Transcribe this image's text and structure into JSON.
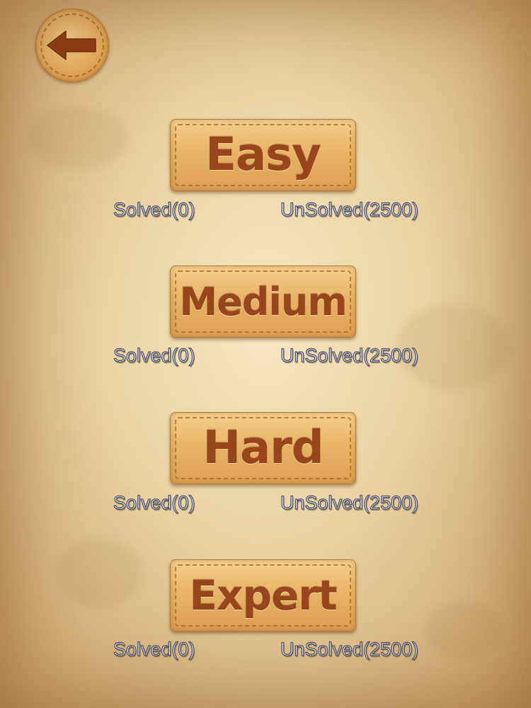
{
  "back_button": {
    "icon": "arrow-left-icon"
  },
  "levels": [
    {
      "label": "Easy",
      "solved": "Solved(0)",
      "unsolved": "UnSolved(2500)"
    },
    {
      "label": "Medium",
      "solved": "Solved(0)",
      "unsolved": "UnSolved(2500)"
    },
    {
      "label": "Hard",
      "solved": "Solved(0)",
      "unsolved": "UnSolved(2500)"
    },
    {
      "label": "Expert",
      "solved": "Solved(0)",
      "unsolved": "UnSolved(2500)"
    }
  ],
  "colors": {
    "button_text": "#97461c",
    "button_fill": "#e8b466",
    "stat_text": "#eef0f5",
    "stat_outline": "#515566",
    "background": "#e4c892"
  }
}
